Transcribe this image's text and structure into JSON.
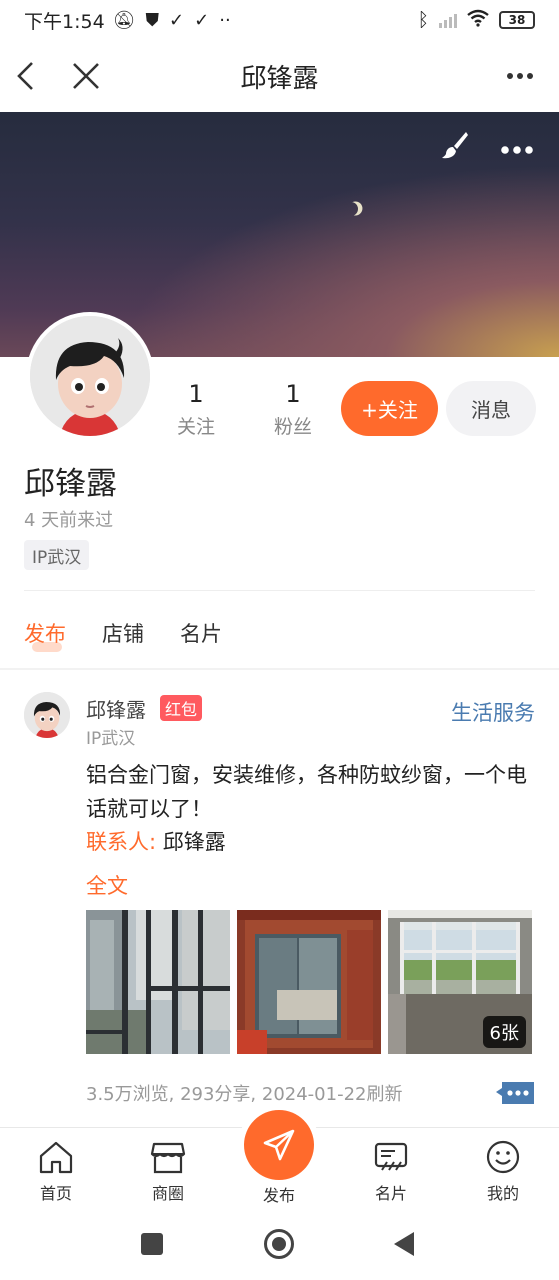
{
  "status_bar": {
    "time": "下午1:54",
    "battery": "38",
    "icons": [
      "mute-icon",
      "shield-icon",
      "download-done-icon",
      "download-done-icon",
      "more-dots-icon",
      "bluetooth-icon",
      "signal-icon",
      "wifi-icon",
      "battery-icon"
    ]
  },
  "header": {
    "title": "邱锋露",
    "icons": [
      "back-icon",
      "close-icon",
      "more-icon"
    ]
  },
  "banner": {
    "icons": [
      "brush-icon",
      "more-icon"
    ]
  },
  "profile": {
    "name": "邱锋露",
    "last_seen": "4 天前来过",
    "ip_tag": "IP武汉",
    "stats": [
      {
        "num": "1",
        "label": "关注"
      },
      {
        "num": "1",
        "label": "粉丝"
      }
    ],
    "follow_label": "+关注",
    "message_label": "消息"
  },
  "tabs": [
    {
      "label": "发布",
      "active": true
    },
    {
      "label": "店铺",
      "active": false
    },
    {
      "label": "名片",
      "active": false
    }
  ],
  "post": {
    "author": "邱锋露",
    "badge": "红包",
    "ip": "IP武汉",
    "category": "生活服务",
    "text": "铝合金门窗，安装维修，各种防蚊纱窗，一个电话就可以了！",
    "contact_key": "联系人:",
    "contact_value": "邱锋露",
    "full_text_label": "全文",
    "photo_count": "6张",
    "meta": "3.5万浏览, 293分享, 2024-01-22刷新"
  },
  "bottom_nav": {
    "items": [
      {
        "label": "首页",
        "icon": "home-icon"
      },
      {
        "label": "商圈",
        "icon": "store-icon"
      },
      {
        "label": "发布",
        "icon": "paper-plane-icon"
      },
      {
        "label": "名片",
        "icon": "card-icon"
      },
      {
        "label": "我的",
        "icon": "smile-icon"
      }
    ]
  },
  "colors": {
    "accent": "#ff6a2c",
    "badge_red": "#ff5a5f",
    "category_blue": "#4a7bb0"
  }
}
